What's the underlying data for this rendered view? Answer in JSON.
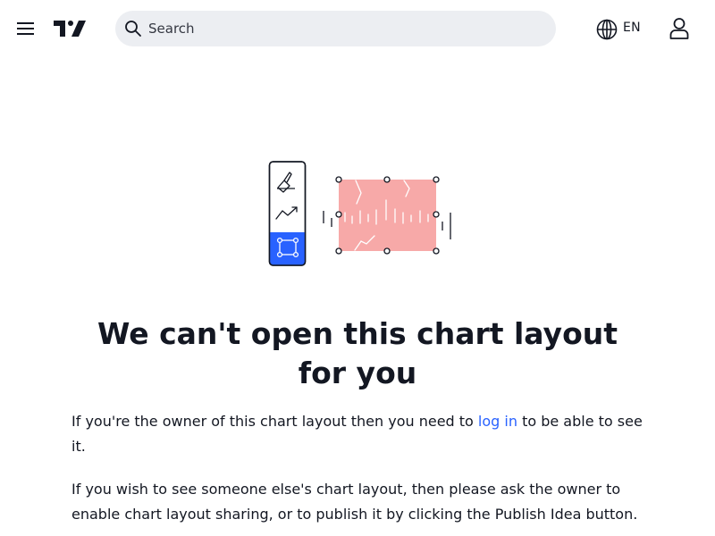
{
  "header": {
    "search_placeholder": "Search",
    "language": "EN"
  },
  "icons": {
    "menu": "menu-icon",
    "logo": "tradingview-logo",
    "search": "search-icon",
    "globe": "globe-icon",
    "user": "user-icon"
  },
  "main": {
    "title": "We can't open this chart layout for you",
    "paragraph1": {
      "before": "If you're the owner of this chart layout then you need to ",
      "link": "log in",
      "after": " to be able to see it."
    },
    "paragraph2": "If you wish to see someone else's chart layout, then please ask the owner to enable chart layout sharing, or to publish it by clicking the Publish Idea button."
  },
  "colors": {
    "accent_blue": "#2962ff",
    "text": "#131722",
    "search_bg": "#eceef2",
    "illustration_pink": "#f7a9a8"
  }
}
